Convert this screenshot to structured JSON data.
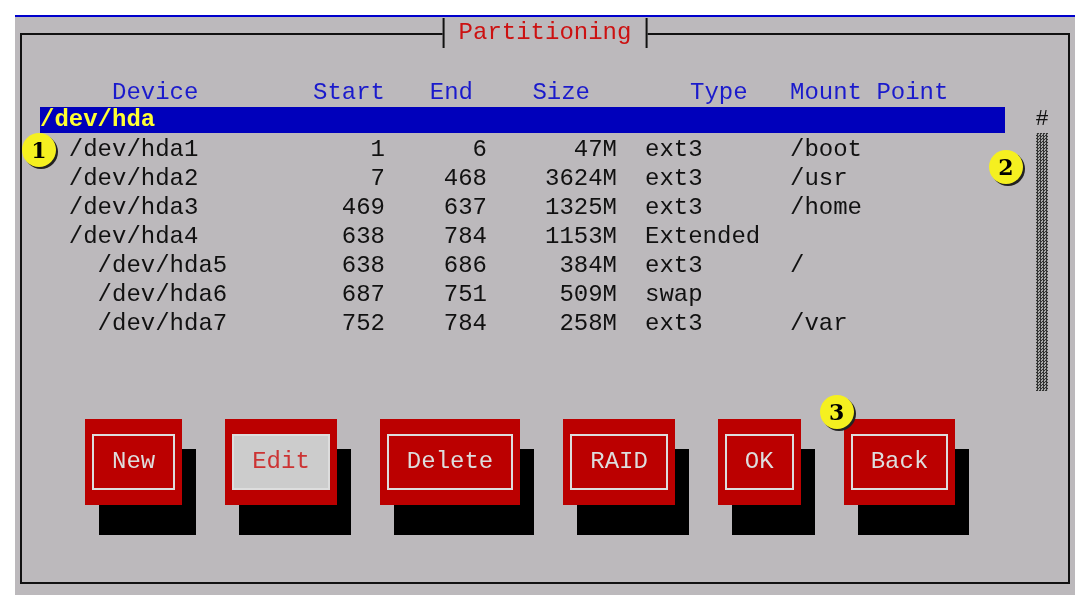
{
  "window": {
    "title": "Partitioning"
  },
  "table": {
    "columns": [
      "Device",
      "Start",
      "End",
      "Size",
      "Type",
      "Mount Point"
    ],
    "disks": [
      {
        "device": "/dev/hda",
        "selected": true,
        "children": [
          {
            "device": "/dev/hda1",
            "start": "1",
            "end": "6",
            "size": "47M",
            "type": "ext3",
            "mount": "/boot",
            "selected": false,
            "callout": "1"
          },
          {
            "device": "/dev/hda2",
            "start": "7",
            "end": "468",
            "size": "3624M",
            "type": "ext3",
            "mount": "/usr",
            "selected": false
          },
          {
            "device": "/dev/hda3",
            "start": "469",
            "end": "637",
            "size": "1325M",
            "type": "ext3",
            "mount": "/home",
            "selected": false
          },
          {
            "device": "/dev/hda4",
            "start": "638",
            "end": "784",
            "size": "1153M",
            "type": "Extended",
            "selected": false,
            "children": [
              {
                "device": "/dev/hda5",
                "start": "638",
                "end": "686",
                "size": "384M",
                "type": "ext3",
                "mount": "/",
                "selected": false
              },
              {
                "device": "/dev/hda6",
                "start": "687",
                "end": "751",
                "size": "509M",
                "type": "swap",
                "selected": false
              },
              {
                "device": "/dev/hda7",
                "start": "752",
                "end": "784",
                "size": "258M",
                "type": "ext3",
                "mount": "/var",
                "selected": false
              }
            ]
          }
        ]
      }
    ]
  },
  "scrollbar": {
    "marker": "#",
    "callout": "2"
  },
  "buttons": [
    {
      "label": "New",
      "selected": false
    },
    {
      "label": "Edit",
      "selected": true
    },
    {
      "label": "Delete",
      "selected": false
    },
    {
      "label": "RAID",
      "selected": false
    },
    {
      "label": "OK",
      "selected": false
    },
    {
      "label": "Back",
      "selected": false,
      "callout": "3"
    }
  ]
}
